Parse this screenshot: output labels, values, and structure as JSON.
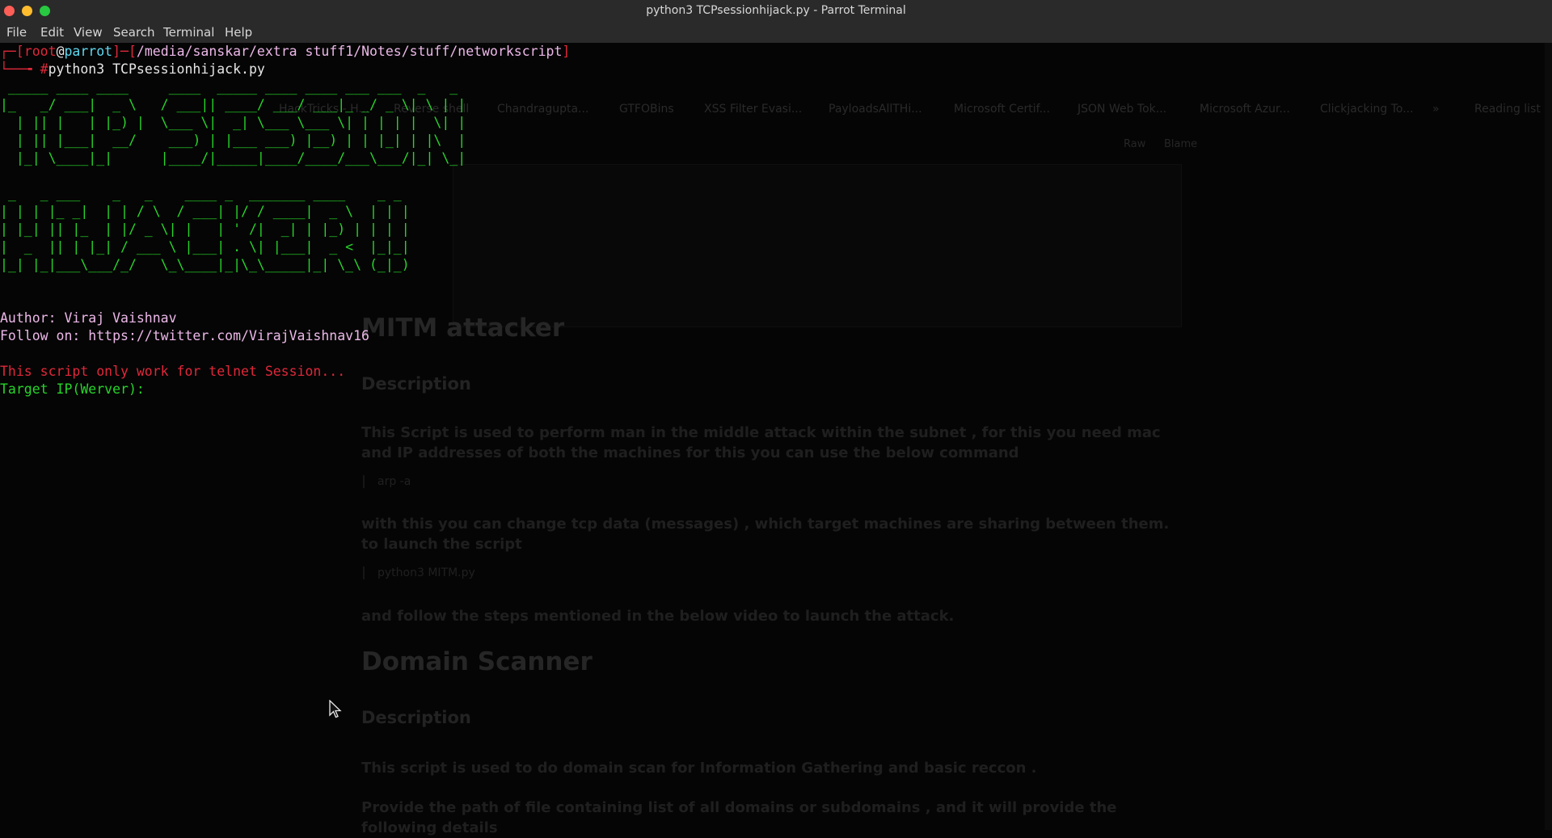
{
  "window": {
    "title": "python3 TCPsessionhijack.py - Parrot Terminal"
  },
  "menu": [
    "File",
    "Edit",
    "View",
    "Search",
    "Terminal",
    "Help"
  ],
  "prompt": {
    "open": "┌─[",
    "user": "root",
    "at": "@",
    "host": "parrot",
    "sep": "]─[",
    "path": "/media/sanskar/extra stuff1/Notes/stuff/networkscript",
    "close": "]",
    "line2": "└──╼ ",
    "hash": "#",
    "command": "python3 TCPsessionhijack.py"
  },
  "banner": [
    " _____ ____ ____     ____  _____ ____ ____ ___ ___  _   _ ",
    "|_   _/ ___|  _ \\   / ___|| ____/ ___/ ___|_ _/ _ \\| \\ | |",
    "  | || |   | |_) |  \\___ \\|  _| \\___ \\___ \\| | | | |  \\| |",
    "  | || |___|  __/    ___) | |___ ___) |__) | | |_| | |\\  |",
    "  |_| \\____|_|      |____/|_____|____/____/___\\___/|_| \\_|",
    "",
    " _   _ ___    _   _    ____ _  _______ ____    _ _ ",
    "| | | |_ _|  | | / \\  / ___| |/ / ____|  _ \\  | | |",
    "| |_| || |_  | |/ _ \\| |   | ' /|  _| | |_) | | | |",
    "|  _  || | |_| / ___ \\ |___| . \\| |___|  _ <  |_|_|",
    "|_| |_|___\\___/_/   \\_\\____|_|\\_\\_____|_| \\_\\ (_|_)"
  ],
  "author_line": "Author: Viraj Vaishnav",
  "follow_line": "Follow on: https://twitter.com/VirajVaishnav16",
  "warning_line": "This script only work for telnet Session...",
  "input_prompt": "Target IP(Werver): ",
  "background_browser": {
    "bookmarks": [
      "HackTricks - H...",
      "Reverse shell",
      "Chandragupta...",
      "GTFOBins",
      "XSS Filter Evasi...",
      "PayloadsAllTHi...",
      "Microsoft Certif...",
      "JSON Web Tok...",
      "Microsoft Azur...",
      "Clickjacking To...",
      "»",
      "Reading list"
    ],
    "buttons": [
      "Raw",
      "Blame"
    ],
    "heading1": "MITM attacker",
    "desc1": "Description",
    "para1": "This Script is used to perform man in the middle attack within the subnet , for this you need mac and IP addresses of both the machines for this you can use the below command",
    "code1": "arp -a",
    "para2": "with this you can change tcp data (messages) , which target machines are sharing between them. to launch the script",
    "code2": "python3 MITM.py",
    "para3": "and follow the steps mentioned in the below video to launch the attack.",
    "heading2": "Domain Scanner",
    "desc2": "Description",
    "para4": "This script is used to do domain scan for Information Gathering and basic reccon .",
    "para5": "Provide the path of file containing list of all domains or subdomains , and it will provide the following details"
  },
  "colors": {
    "prompt_red": "#e0283a",
    "banner_green": "#27d52a",
    "author_pink": "#ecb8e8",
    "host_cyan": "#5fd8f0"
  }
}
